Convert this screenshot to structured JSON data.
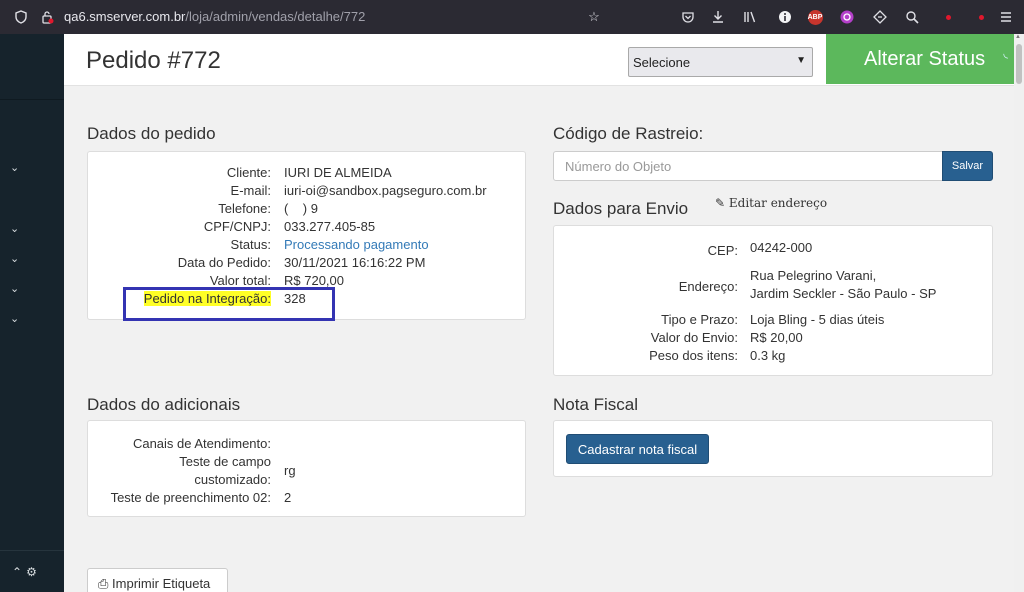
{
  "browser": {
    "url_host": "qa6.smserver.com.br",
    "url_path": "/loja/admin/vendas/detalhe/772",
    "extension_abp": "ABP"
  },
  "header": {
    "title": "Pedido #772",
    "status_select_value": "Selecione",
    "alterar_status_label": "Alterar Status"
  },
  "dados_pedido": {
    "title": "Dados do pedido",
    "rows": [
      {
        "label": "Cliente:",
        "value": "IURI DE ALMEIDA"
      },
      {
        "label": "E-mail:",
        "value": "iuri-oi@sandbox.pagseguro.com.br"
      },
      {
        "label": "Telefone:",
        "value": "(    ) 9"
      },
      {
        "label": "CPF/CNPJ:",
        "value": "033.277.405-85"
      },
      {
        "label": "Status:",
        "value": "Processando pagamento"
      },
      {
        "label": "Data do Pedido:",
        "value": "30/11/2021 16:16:22 PM"
      },
      {
        "label": "Valor total:",
        "value": "R$ 720,00"
      },
      {
        "label": "Pedido na Integração:",
        "value": "328"
      }
    ]
  },
  "rastreio": {
    "title": "Código de Rastreio:",
    "placeholder": "Número do Objeto",
    "save_label": "Salvar"
  },
  "envio": {
    "title": "Dados para Envio",
    "edit_label": "Editar endereço",
    "cep_label": "CEP:",
    "cep_value": "04242-000",
    "endereco_label": "Endereço:",
    "endereco_line1": "Rua Pelegrino Varani,",
    "endereco_line2": "Jardim Seckler - São Paulo - SP",
    "rows": [
      {
        "label": "Tipo e Prazo:",
        "value": "Loja Bling - 5 dias úteis"
      },
      {
        "label": "Valor do Envio:",
        "value": "R$ 20,00"
      },
      {
        "label": "Peso dos itens:",
        "value": "0.3 kg"
      }
    ]
  },
  "adicionais": {
    "title": "Dados do adicionais",
    "canais_label": "Canais de Atendimento:",
    "campo_label_1": "Teste de campo",
    "campo_label_2": "customizado:",
    "campo_value": "rg",
    "preench_label": "Teste de preenchimento 02:",
    "preench_value": "2"
  },
  "nota_fiscal": {
    "title": "Nota Fiscal",
    "button_label": "Cadastrar nota fiscal"
  },
  "footer": {
    "print_label": "Imprimir Etiqueta"
  },
  "colors": {
    "success": "#5cb85c",
    "primary": "#286090",
    "highlight": "#ffff26",
    "annotation_box": "#3434b2",
    "sidebar": "#16232c",
    "link": "#337ab7"
  }
}
